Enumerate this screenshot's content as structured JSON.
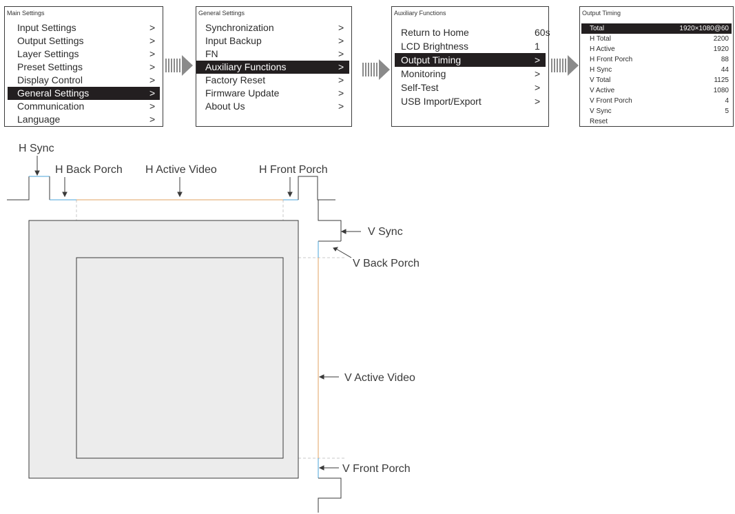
{
  "panels": [
    {
      "id": "main-settings",
      "title": "Main Settings",
      "items": [
        {
          "label": "Input Settings",
          "value": ">"
        },
        {
          "label": "Output Settings",
          "value": ">"
        },
        {
          "label": "Layer Settings",
          "value": ">"
        },
        {
          "label": "Preset Settings",
          "value": ">"
        },
        {
          "label": "Display Control",
          "value": ">"
        },
        {
          "label": "General Settings",
          "value": ">",
          "selected": true
        },
        {
          "label": "Communication",
          "value": ">"
        },
        {
          "label": "Language",
          "value": ">"
        }
      ]
    },
    {
      "id": "general-settings",
      "title": "General Settings",
      "items": [
        {
          "label": "Synchronization",
          "value": ">"
        },
        {
          "label": "Input Backup",
          "value": ">"
        },
        {
          "label": "FN",
          "value": ">"
        },
        {
          "label": "Auxiliary Functions",
          "value": ">",
          "selected": true
        },
        {
          "label": "Factory Reset",
          "value": ">"
        },
        {
          "label": "Firmware Update",
          "value": ">"
        },
        {
          "label": "About Us",
          "value": ">"
        }
      ]
    },
    {
      "id": "auxiliary-functions",
      "title": "Auxiliary Functions",
      "items": [
        {
          "label": "Return to Home",
          "value": "60s"
        },
        {
          "label": "LCD Brightness",
          "value": "1"
        },
        {
          "label": "Output Timing",
          "value": ">",
          "selected": true
        },
        {
          "label": "Monitoring",
          "value": ">"
        },
        {
          "label": "Self-Test",
          "value": ">"
        },
        {
          "label": "USB Import/Export",
          "value": ">"
        }
      ]
    },
    {
      "id": "output-timing",
      "title": "Output Timing",
      "items": [
        {
          "label": "Total",
          "value": "1920×1080@60",
          "selected": true
        },
        {
          "label": "H Total",
          "value": "2200"
        },
        {
          "label": "H Active",
          "value": "1920"
        },
        {
          "label": "H Front Porch",
          "value": "88"
        },
        {
          "label": "H Sync",
          "value": "44"
        },
        {
          "label": "V Total",
          "value": "1125"
        },
        {
          "label": "V Active",
          "value": "1080"
        },
        {
          "label": "V Front Porch",
          "value": "4"
        },
        {
          "label": "V Sync",
          "value": "5"
        },
        {
          "label": "Reset",
          "value": ""
        }
      ]
    }
  ],
  "arrow_icon": "double-right-arrow-icon",
  "diagram": {
    "labels": {
      "h_sync": "H Sync",
      "h_back_porch": "H Back Porch",
      "h_active_video": "H Active Video",
      "h_front_porch": "H Front Porch",
      "v_sync": "V Sync",
      "v_back_porch": "V Back Porch",
      "v_active_video": "V Active Video",
      "v_front_porch": "V Front Porch"
    },
    "colors": {
      "sync": "#4aa3d8",
      "active": "#e0a060",
      "line": "#3a3a3a",
      "screen_fill": "#ececec",
      "guide": "#c8c8c8"
    }
  }
}
